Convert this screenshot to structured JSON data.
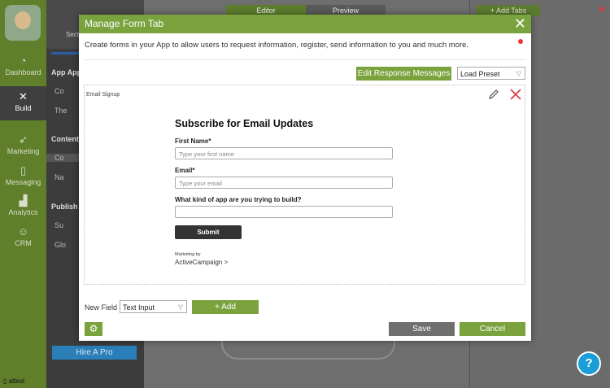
{
  "nav": {
    "items": [
      {
        "label": "Dashboard",
        "icon": "dashboard-icon"
      },
      {
        "label": "Build",
        "icon": "build-icon",
        "active": true
      },
      {
        "label": "Marketing",
        "icon": "rocket-icon"
      },
      {
        "label": "Messaging",
        "icon": "messaging-icon"
      },
      {
        "label": "Analytics",
        "icon": "analytics-icon"
      },
      {
        "label": "CRM",
        "icon": "person-icon"
      }
    ],
    "user": "attest"
  },
  "side": {
    "sections_label": "Secti",
    "heading1": "App Appe",
    "item1": "Co",
    "item2": "The",
    "heading2": "Content",
    "item3": "Co",
    "item4": "Na",
    "heading3": "Publish",
    "item5": "Su",
    "item6": "Glo",
    "hire": "Hire A Pro"
  },
  "center": {
    "editor": "Editor",
    "preview": "Preview"
  },
  "right": {
    "add_tabs": "+ Add Tabs"
  },
  "modal": {
    "title": "Manage Form Tab",
    "description": "Create forms in your App to allow users to request information, register, send information to you and much more.",
    "edit_response": "Edit Response Messages",
    "load_preset": "Load Preset",
    "form_label": "Email Signup",
    "form": {
      "title": "Subscribe for Email Updates",
      "first_name_label": "First Name*",
      "first_name_placeholder": "Type your first name",
      "email_label": "Email*",
      "email_placeholder": "Type your email",
      "app_label": "What kind of app are you trying to build?",
      "submit": "Submit",
      "marketing_by": "Marketing by",
      "brand": "ActiveCampaign >"
    },
    "new_field_label": "New Field",
    "field_type": "Text Input",
    "add": "+ Add",
    "save": "Save",
    "cancel": "Cancel"
  }
}
